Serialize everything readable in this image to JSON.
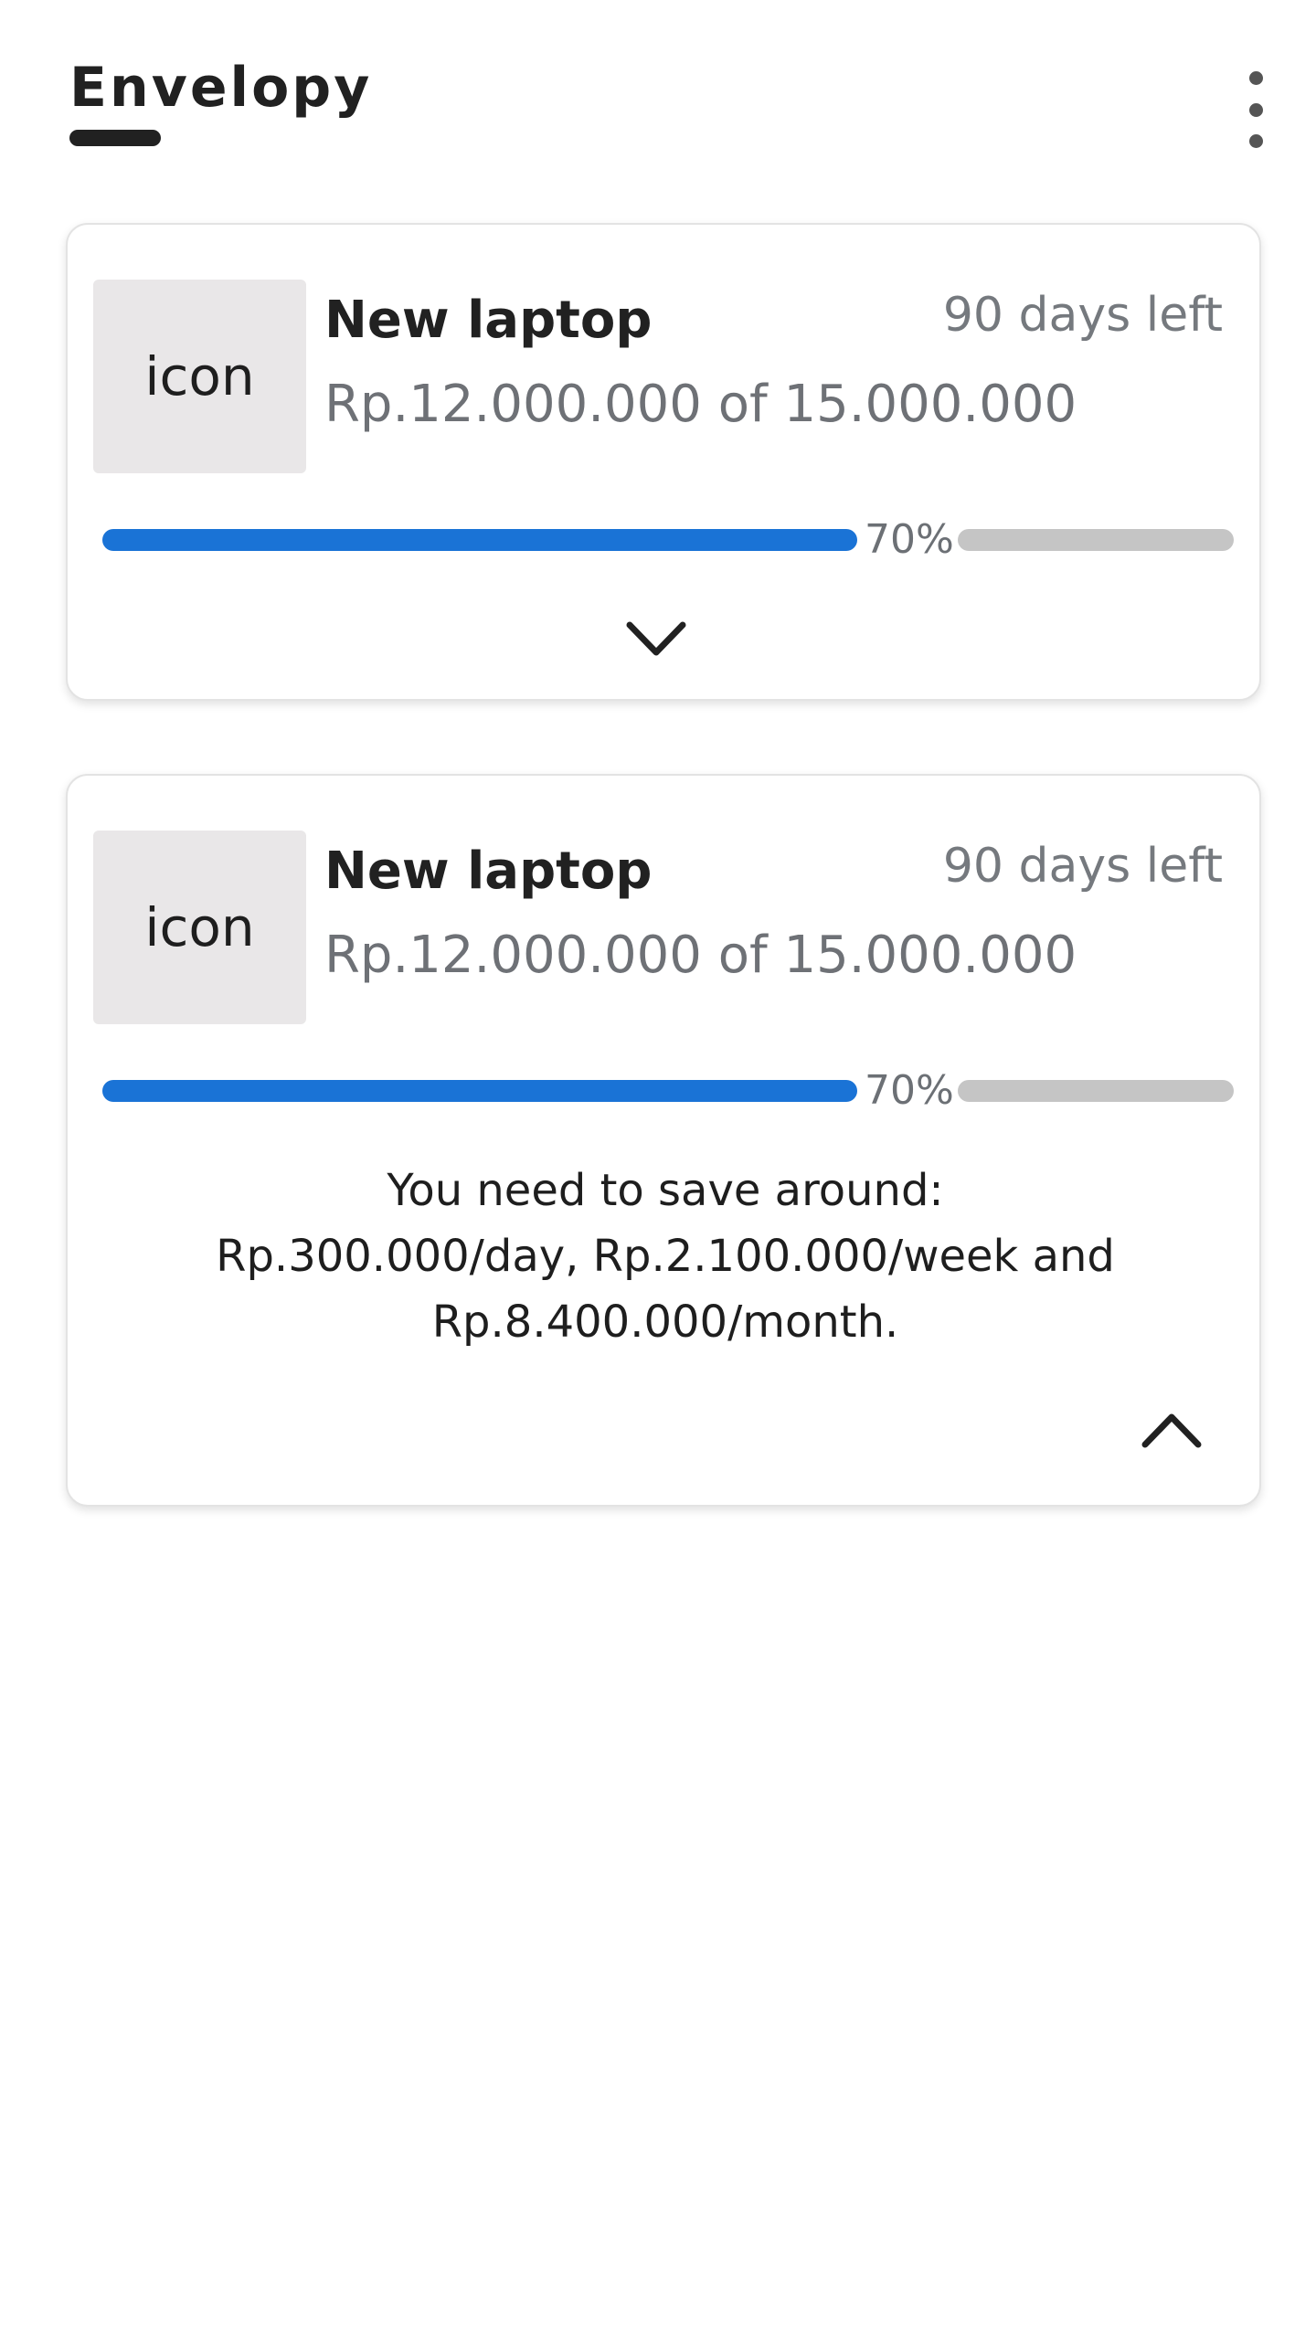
{
  "app": {
    "title": "Envelopy"
  },
  "cards": [
    {
      "icon_placeholder": "icon",
      "title": "New laptop",
      "days_left": "90 days left",
      "amount": "Rp.12.000.000 of 15.000.000",
      "progress_percent": 70,
      "progress_label": "70%",
      "expanded": false,
      "toggle_icon": "chevron-down-icon"
    },
    {
      "icon_placeholder": "icon",
      "title": "New laptop",
      "days_left": "90 days left",
      "amount": "Rp.12.000.000 of 15.000.000",
      "progress_percent": 70,
      "progress_label": "70%",
      "expanded": true,
      "saving_text": [
        "You need to save around:",
        "Rp.300.000/day, Rp.2.100.000/week and",
        "Rp.8.400.000/month."
      ],
      "toggle_icon": "chevron-up-icon"
    }
  ],
  "colors": {
    "progress_fill": "#1a73d6",
    "progress_rest": "#c5c5c5",
    "text_dark": "#212121",
    "text_muted": "#6e7176"
  },
  "header": {
    "menu_icon": "more-vertical-icon"
  }
}
